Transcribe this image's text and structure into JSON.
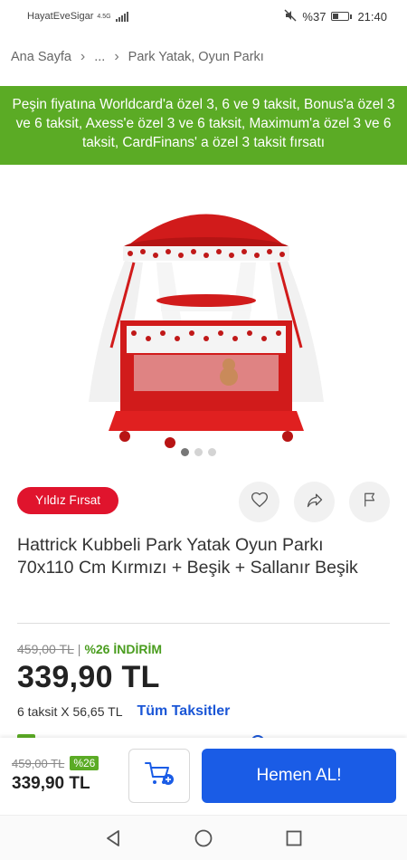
{
  "status_bar": {
    "carrier": "HayatEveSigar",
    "network": "4.5G",
    "battery": "%37",
    "battery_level": 0.37,
    "time": "21:40"
  },
  "breadcrumb": {
    "items": [
      "Ana Sayfa",
      "...",
      "Park Yatak, Oyun Parkı"
    ]
  },
  "promo": {
    "text": "Peşin fiyatına Worldcard'a özel 3, 6 ve 9 taksit, Bonus'a özel 3 ve 6 taksit, Axess'e özel 3 ve 6 taksit, Maximum'a özel 3 ve 6 taksit, CardFinans' a özel 3 taksit fırsatı"
  },
  "gallery": {
    "image_count": 3,
    "active_index": 0
  },
  "product": {
    "badge": "Yıldız Fırsat",
    "title": "Hattrick Kubbeli Park Yatak Oyun Parkı 70x110 Cm Kırmızı + Beşik + Sallanır Beşik",
    "old_price": "459,00 TL",
    "price_separator": "|",
    "discount": "%26 İNDİRİM",
    "price": "339,90 TL",
    "installment": "6 taksit X 56,65 TL",
    "all_installments": "Tüm Taksitler"
  },
  "bottom_bar": {
    "old_price": "459,00 TL",
    "discount": "%26",
    "price": "339,90 TL",
    "buy_label": "Hemen AL!"
  },
  "colors": {
    "promo_green": "#5bab25",
    "badge_red": "#e0142d",
    "primary_blue": "#1a5ce6"
  },
  "icons": [
    "mute-icon",
    "battery-icon",
    "chevron-right-icon",
    "heart-icon",
    "share-icon",
    "flag-icon",
    "add-to-cart-icon",
    "back-icon",
    "home-icon",
    "recent-apps-icon"
  ]
}
